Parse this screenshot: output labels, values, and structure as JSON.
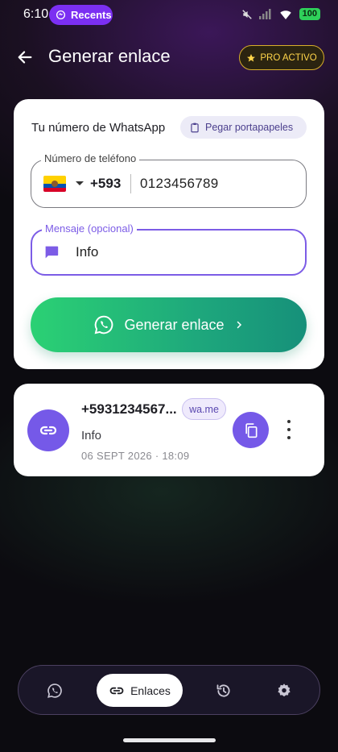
{
  "status_bar": {
    "time": "6:10",
    "recents_label": "Recents",
    "battery": "100"
  },
  "header": {
    "title": "Generar enlace",
    "pro_badge": "PRO ACTIVO"
  },
  "generator": {
    "label": "Tu número de WhatsApp",
    "paste_button": "Pegar portapapeles",
    "phone_legend": "Número de teléfono",
    "country_flag": "ecuador-flag",
    "dial_code": "+593",
    "phone_value": "0123456789",
    "message_legend": "Mensaje (opcional)",
    "message_value": "Info",
    "generate_button": "Generar enlace"
  },
  "history_item": {
    "number": "+5931234567...",
    "domain_badge": "wa.me",
    "message": "Info",
    "date": "06 SEPT 2026 · 18:09"
  },
  "bottom_nav": {
    "items": [
      {
        "icon": "whatsapp-icon",
        "label": ""
      },
      {
        "icon": "link-icon",
        "label": "Enlaces"
      },
      {
        "icon": "history-icon",
        "label": ""
      },
      {
        "icon": "gear-icon",
        "label": ""
      }
    ]
  },
  "colors": {
    "accent_purple": "#7559e8",
    "pro_gold": "#ffd54a",
    "gradient_start": "#2bd174",
    "gradient_end": "#16907a"
  }
}
